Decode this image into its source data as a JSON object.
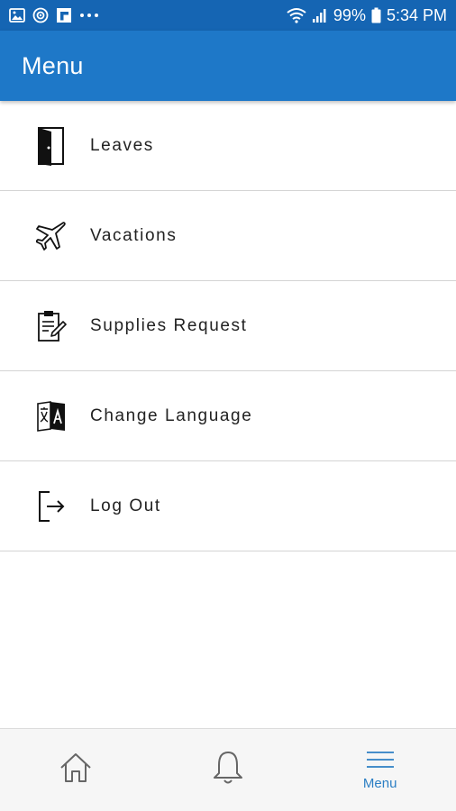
{
  "status_bar": {
    "battery": "99%",
    "time": "5:34 PM",
    "left_icons": [
      "gallery-icon",
      "target-icon",
      "flipboard-icon",
      "more-notifications-icon"
    ],
    "right_icons": [
      "wifi-icon",
      "signal-icon",
      "battery-icon"
    ]
  },
  "app_bar": {
    "title": "Menu"
  },
  "menu": {
    "items": [
      {
        "label": "Leaves",
        "icon": "door-icon"
      },
      {
        "label": "Vacations",
        "icon": "airplane-icon"
      },
      {
        "label": "Supplies Request",
        "icon": "clipboard-edit-icon"
      },
      {
        "label": "Change Language",
        "icon": "translate-icon"
      },
      {
        "label": "Log Out",
        "icon": "logout-icon"
      }
    ]
  },
  "bottom_nav": {
    "items": [
      {
        "icon": "home-icon",
        "label": ""
      },
      {
        "icon": "bell-icon",
        "label": ""
      },
      {
        "icon": "hamburger-menu-icon",
        "label": "Menu",
        "active": true
      }
    ]
  },
  "colors": {
    "status_bar": "#1565b3",
    "app_bar": "#1e78c8",
    "active_nav": "#2c7fc4"
  }
}
